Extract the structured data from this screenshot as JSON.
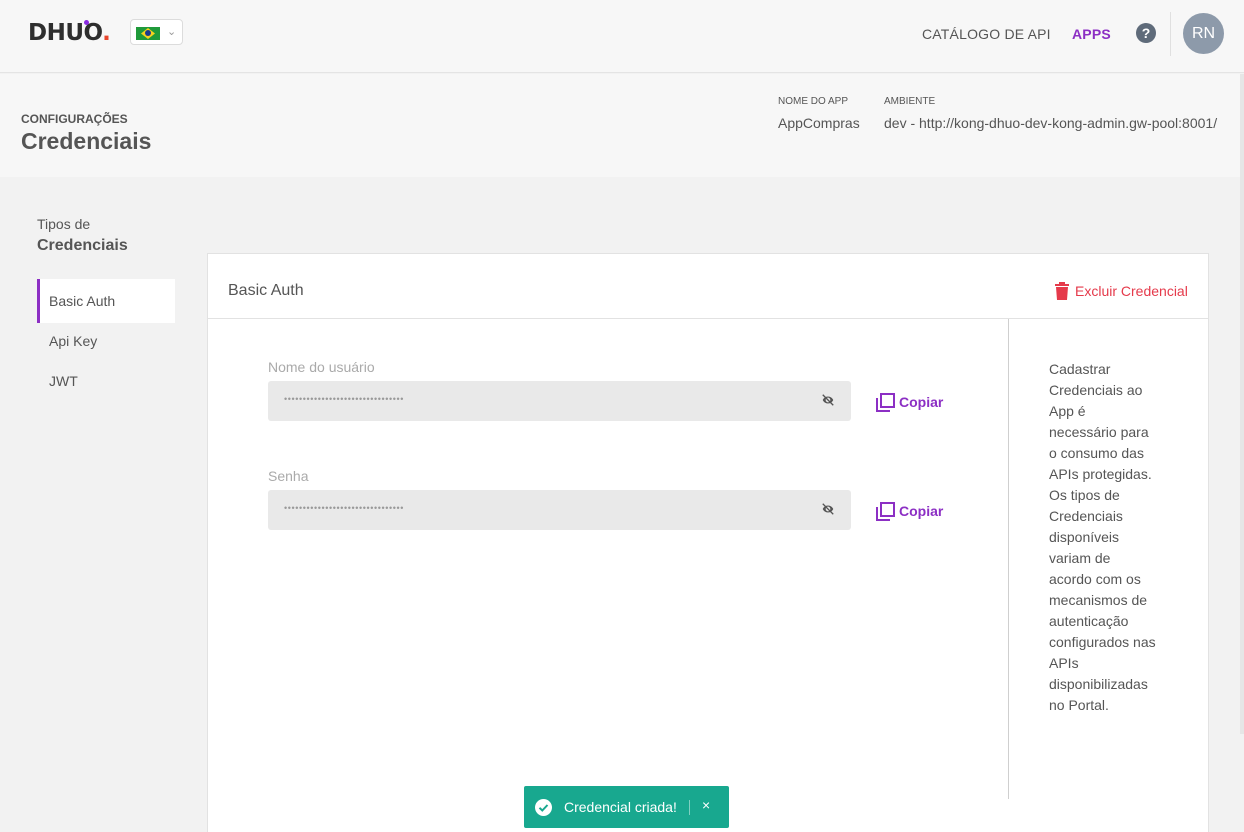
{
  "nav": {
    "logo_text": "DHUO",
    "language_flag": "brazil-flag",
    "catalog_label": "CATÁLOGO DE API",
    "apps_label": "APPS",
    "help_label": "?",
    "avatar_initials": "RN"
  },
  "header": {
    "eyebrow": "CONFIGURAÇÕES",
    "title": "Credenciais",
    "app_name_label": "NOME DO APP",
    "app_name_value": "AppCompras",
    "env_label": "AMBIENTE",
    "env_value": "dev - http://kong-dhuo-dev-kong-admin.gw-pool:8001/"
  },
  "sidebar": {
    "eyebrow": "Tipos de",
    "title": "Credenciais",
    "items": [
      {
        "label": "Basic Auth",
        "active": true
      },
      {
        "label": "Api Key",
        "active": false
      },
      {
        "label": "JWT",
        "active": false
      }
    ]
  },
  "card": {
    "title": "Basic Auth",
    "delete_label": "Excluir Credencial",
    "fields": [
      {
        "label": "Nome do usuário",
        "value": "••••••••••••••••••••••••••••••••",
        "copy_label": "Copiar"
      },
      {
        "label": "Senha",
        "value": "••••••••••••••••••••••••••••••••",
        "copy_label": "Copiar"
      }
    ],
    "help_text": "Cadastrar Credenciais ao App é necessário para o consumo das APIs protegidas. Os tipos de Credenciais disponíveis variam de acordo com os mecanismos de autenticação configurados nas APIs disponibilizadas no Portal."
  },
  "toast": {
    "message": "Credencial criada!",
    "close_label": "×"
  },
  "colors": {
    "accent": "#8c2fc4",
    "danger": "#e53a4b",
    "success": "#18a88f"
  }
}
